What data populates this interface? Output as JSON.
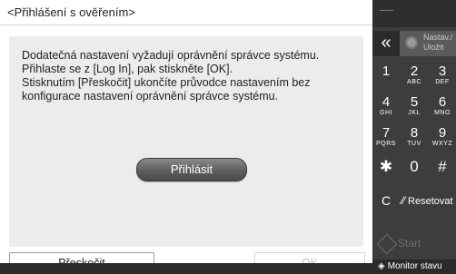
{
  "dialog": {
    "title": "<Přihlášení s ověřením>",
    "message": "Dodatečná nastavení vyžadují oprávnění správce systému.\nPřihlaste se z [Log In], pak stiskněte [OK].\nStisknutím [Přeskočit] ukončíte průvodce nastavením bez\nkonfigurace nastavení oprávnění správce systému.",
    "login_button": "Přihlásit",
    "skip_button": "Přeskočit",
    "ok_button": "OK"
  },
  "keypad": {
    "top_dots": "-----",
    "back_icon": "«",
    "settings_label": "Nastav./\nUložit",
    "keys": [
      {
        "digit": "1",
        "letters": ""
      },
      {
        "digit": "2",
        "letters": "ABC"
      },
      {
        "digit": "3",
        "letters": "DEF"
      },
      {
        "digit": "4",
        "letters": "GHI"
      },
      {
        "digit": "5",
        "letters": "JKL"
      },
      {
        "digit": "6",
        "letters": "MNO"
      },
      {
        "digit": "7",
        "letters": "PQRS"
      },
      {
        "digit": "8",
        "letters": "TUV"
      },
      {
        "digit": "9",
        "letters": "WXYZ"
      },
      {
        "digit": "✱",
        "letters": ""
      },
      {
        "digit": "0",
        "letters": ""
      },
      {
        "digit": "#",
        "letters": ""
      }
    ],
    "clear_key": "C",
    "reset_label": "Resetovat",
    "start_label": "Start",
    "monitor_label": "Monitor stavu"
  }
}
